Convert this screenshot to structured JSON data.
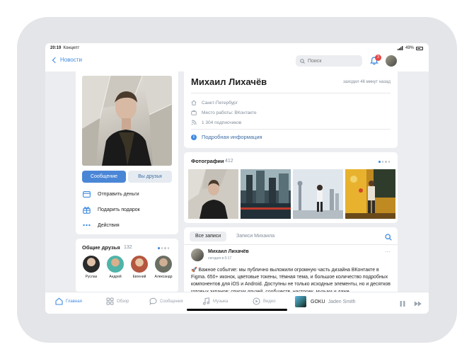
{
  "status_bar": {
    "time": "20:19",
    "carrier": "Концепт",
    "battery": "49%"
  },
  "nav": {
    "back_label": "Новости",
    "search_placeholder": "Поиск",
    "notification_count": "3"
  },
  "profile": {
    "name": "Михаил Лихачёв",
    "last_seen": "заходил 46 минут назад",
    "city": "Санкт-Петербург",
    "work": "Место работы: ВКонтакте",
    "followers": "1 304 подписчиков",
    "more_info": "Подробная информация",
    "message_button": "Сообщение",
    "friends_button": "Вы друзья",
    "actions": [
      "Отправить деньги",
      "Подарить подарок",
      "Действия"
    ]
  },
  "friends": {
    "title": "Общие друзья",
    "count": "132",
    "items": [
      {
        "name": "Руслан",
        "color": "#2b2b2b"
      },
      {
        "name": "Андрей",
        "color": "#4fb3a8"
      },
      {
        "name": "Евгений",
        "color": "#b5563f"
      },
      {
        "name": "Александр",
        "color": "#6b6f63"
      }
    ]
  },
  "photos": {
    "title": "Фотографии",
    "count": "412"
  },
  "wall": {
    "tabs": [
      "Все записи",
      "Записи Михаила"
    ],
    "post": {
      "author": "Михаил Лихачёв",
      "time": "сегодня в 0:17",
      "text": "🚀 Важное событие: мы публично выложили огромную часть дизайна ВКонтакте в Figma. 650+ иконок, цветовые токены, тёмная тема, и большое количество подробных компонентов для iOS и Android. Доступны не только исходные элементы, но и десятков готовых экранов: списки друзей, сообществ, настроек, музыки и даже"
    }
  },
  "tabbar": {
    "tabs": [
      "Главная",
      "Обзор",
      "Сообщения",
      "Музыка",
      "Видео"
    ],
    "player": {
      "song": "GOKU",
      "artist": "Jaden Smith"
    }
  },
  "colors": {
    "accent": "#3f8ae0",
    "primary_button": "#4a86d6",
    "badge": "#e64646"
  }
}
